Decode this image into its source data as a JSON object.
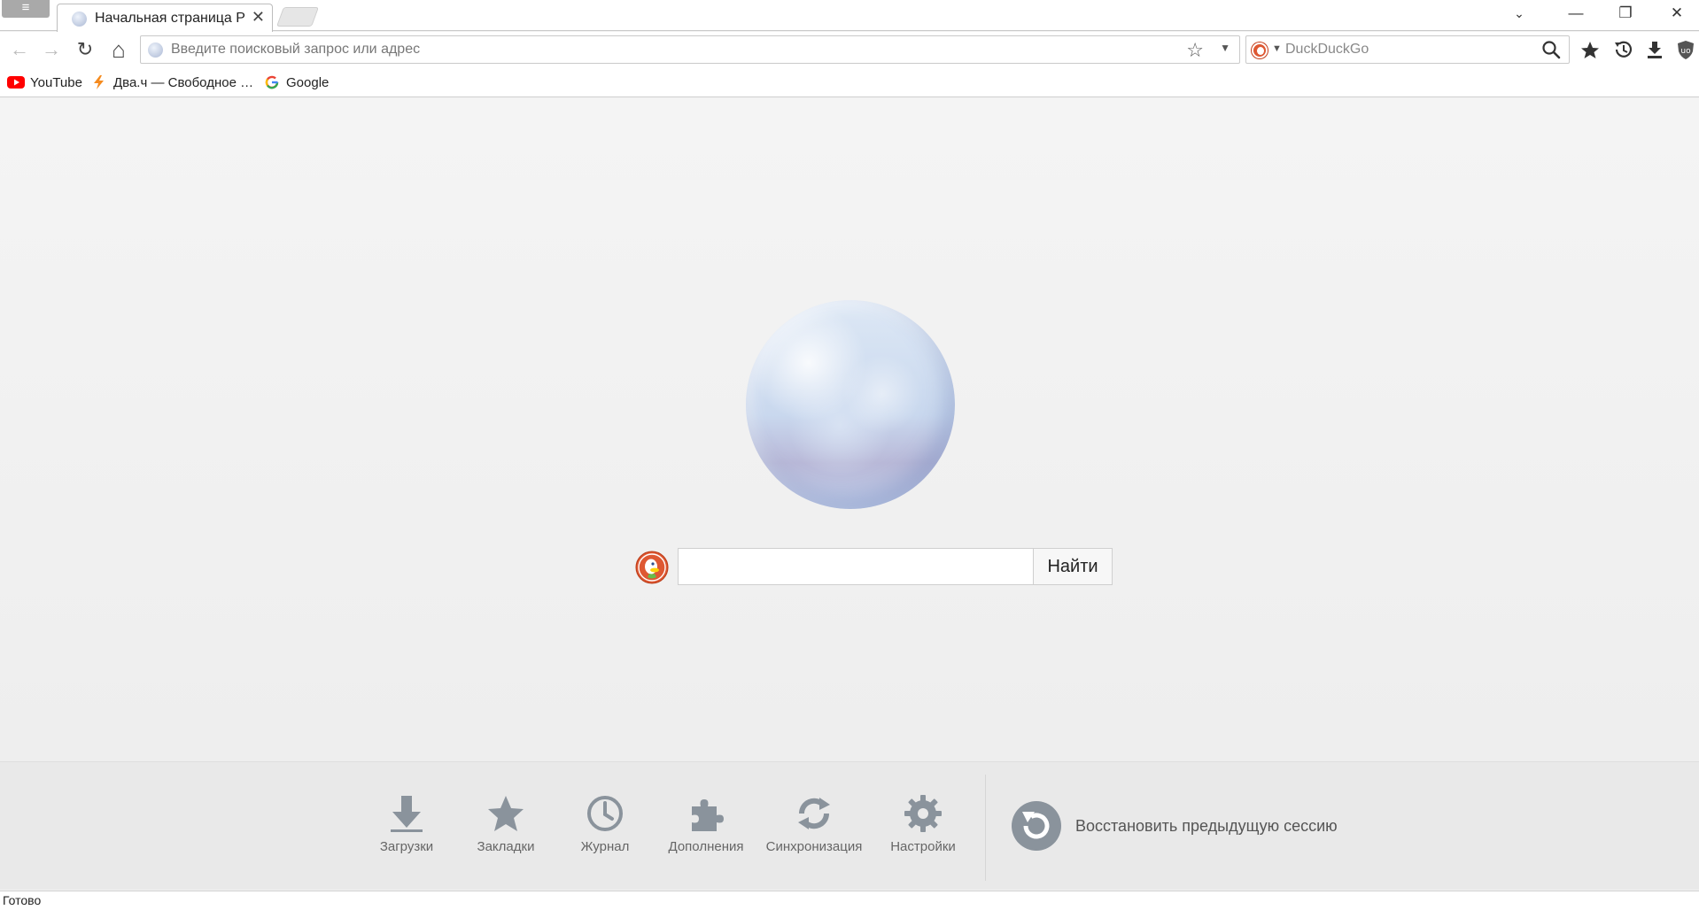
{
  "titlebar": {
    "menu_label": "≡",
    "tab_title": "Начальная страница Р…",
    "close_glyph": "✕",
    "win_dropdown": "⌄",
    "win_minimize": "—",
    "win_restore": "❐",
    "win_close": "✕"
  },
  "navbar": {
    "back_glyph": "←",
    "forward_glyph": "→",
    "reload_glyph": "↻",
    "home_glyph": "⌂",
    "url_placeholder": "Введите поисковый запрос или адрес",
    "url_value": "",
    "star_glyph": "☆",
    "dropdown_glyph": "▼",
    "search_engine_dropdown": "▼",
    "search_placeholder": "DuckDuckGo",
    "search_value": ""
  },
  "bookmarks": [
    {
      "label": "YouTube",
      "icon": "youtube-icon"
    },
    {
      "label": "Два.ч — Свободное …",
      "icon": "lightning-icon"
    },
    {
      "label": "Google",
      "icon": "google-icon"
    }
  ],
  "start_page": {
    "search_value": "",
    "find_label": "Найти"
  },
  "quick_launch": [
    {
      "label": "Загрузки",
      "icon": "download-icon"
    },
    {
      "label": "Закладки",
      "icon": "star-icon"
    },
    {
      "label": "Журнал",
      "icon": "clock-icon"
    },
    {
      "label": "Дополнения",
      "icon": "puzzle-icon"
    },
    {
      "label": "Синхронизация",
      "icon": "sync-icon"
    },
    {
      "label": "Настройки",
      "icon": "gear-icon"
    }
  ],
  "restore_session": {
    "label": "Восстановить предыдущую сессию",
    "icon": "restore-icon"
  },
  "status": {
    "text": "Готово"
  },
  "colors": {
    "icon_gray": "#8a939c",
    "ddg_orange": "#de5833",
    "youtube_red": "#ff0000"
  }
}
